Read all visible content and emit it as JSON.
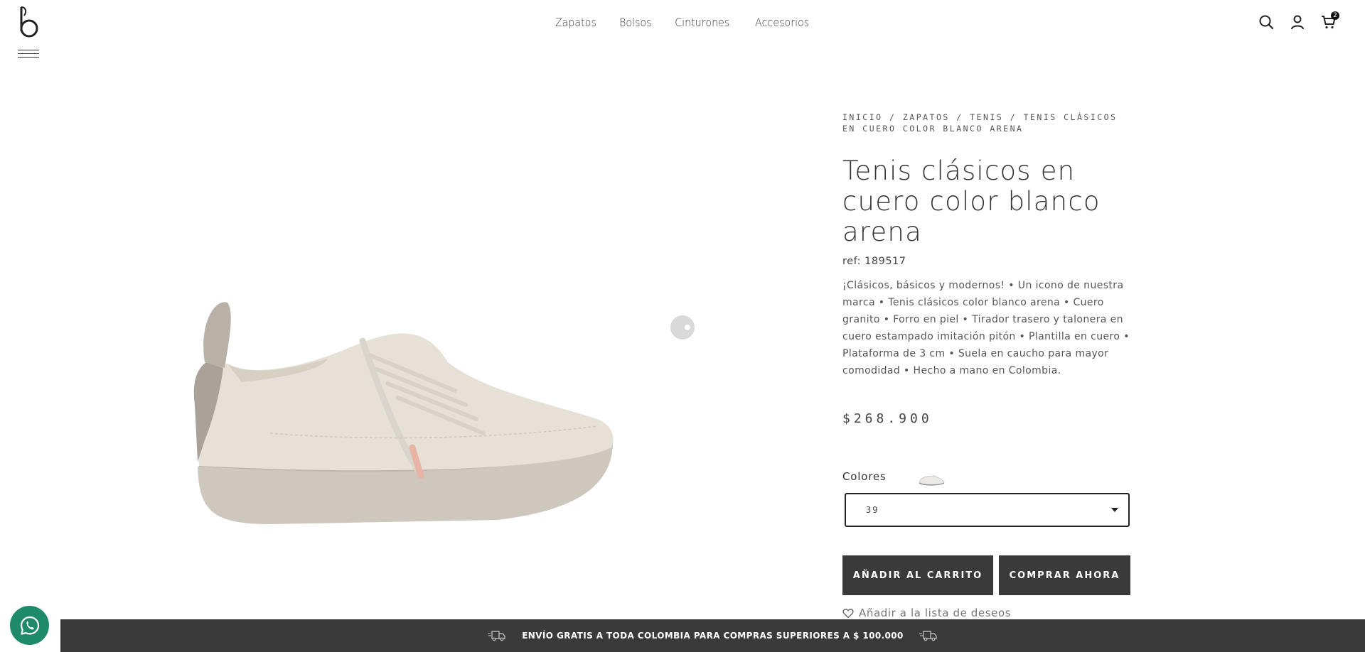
{
  "header": {
    "nav": [
      "Zapatos",
      "Bolsos",
      "Cinturones",
      "Accesorios"
    ],
    "cart_count": "2"
  },
  "product": {
    "breadcrumb": [
      "Inicio",
      "Zapatos",
      "Tenis",
      "Tenis clásicos en cuero color blanco arena"
    ],
    "breadcrumb_separator": "/",
    "title": "Tenis clásicos en cuero color blanco arena",
    "ref": "ref: 189517",
    "description": "¡Clásicos, básicos y modernos! • Un icono de nuestra marca • Tenis clásicos color blanco arena • Cuero granito • Forro en piel • Tirador trasero y talonera en cuero estampado imitación pitón • Plantilla en cuero • Plataforma de 3 cm • Suela en caucho para mayor comodidad • Hecho a mano en Colombia.",
    "price": "$268.900",
    "colors_label": "Colores",
    "size_selected": "39",
    "add_to_cart": "AÑADIR AL CARRITO",
    "buy_now": "COMPRAR AHORA",
    "wishlist": "Añadir a la lista de deseos"
  },
  "banner": {
    "text": "ENVÍO GRATIS A TODA COLOMBIA PARA COMPRAS SUPERIORES A $ 100.000"
  },
  "colors": {
    "banner_bg": "#3a3a3a",
    "button_bg": "#3a3a3a",
    "whatsapp": "#1e8a6a"
  }
}
